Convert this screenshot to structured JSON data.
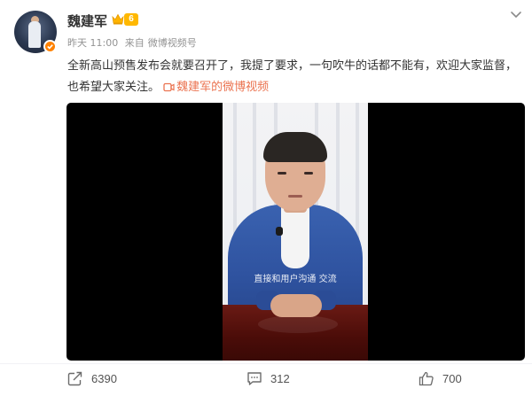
{
  "author": {
    "name": "魏建军",
    "level": "6",
    "avatar_badge": "verified-orange"
  },
  "meta": {
    "time": "昨天 11:00",
    "source_prefix": "来自",
    "source": "微博视频号"
  },
  "post": {
    "text": "全新高山预售发布会就要召开了，我提了要求，一句吹牛的话都不能有，欢迎大家监督，也希望大家关注。",
    "video_link": "魏建军的微博视频"
  },
  "video": {
    "subtitle": "直接和用户沟通 交流"
  },
  "actions": {
    "share": "6390",
    "comment": "312",
    "like": "700"
  },
  "colors": {
    "link": "#eb7350",
    "badge": "#ff8200",
    "level": "#ffb800"
  }
}
